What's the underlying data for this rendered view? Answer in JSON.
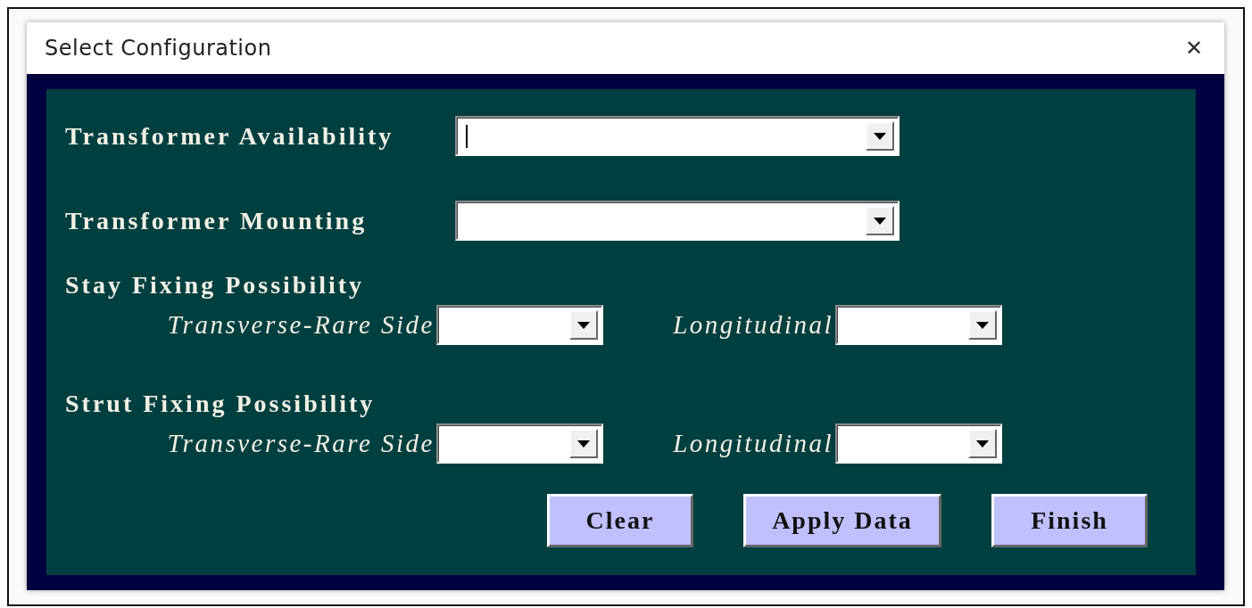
{
  "window": {
    "title": "Select Configuration",
    "close": "✕"
  },
  "fields": [
    {
      "label": "Transformer Availability",
      "focused": true
    },
    {
      "label": "Transformer Mounting",
      "focused": false
    }
  ],
  "groups": [
    {
      "heading": "Stay Fixing Possibility",
      "fields": [
        {
          "label": "Transverse-Rare Side"
        },
        {
          "label": "Longitudinal"
        }
      ]
    },
    {
      "heading": "Strut Fixing Possibility",
      "fields": [
        {
          "label": "Transverse-Rare Side"
        },
        {
          "label": "Longitudinal"
        }
      ]
    }
  ],
  "buttons": [
    "Clear",
    "Apply Data",
    "Finish"
  ]
}
